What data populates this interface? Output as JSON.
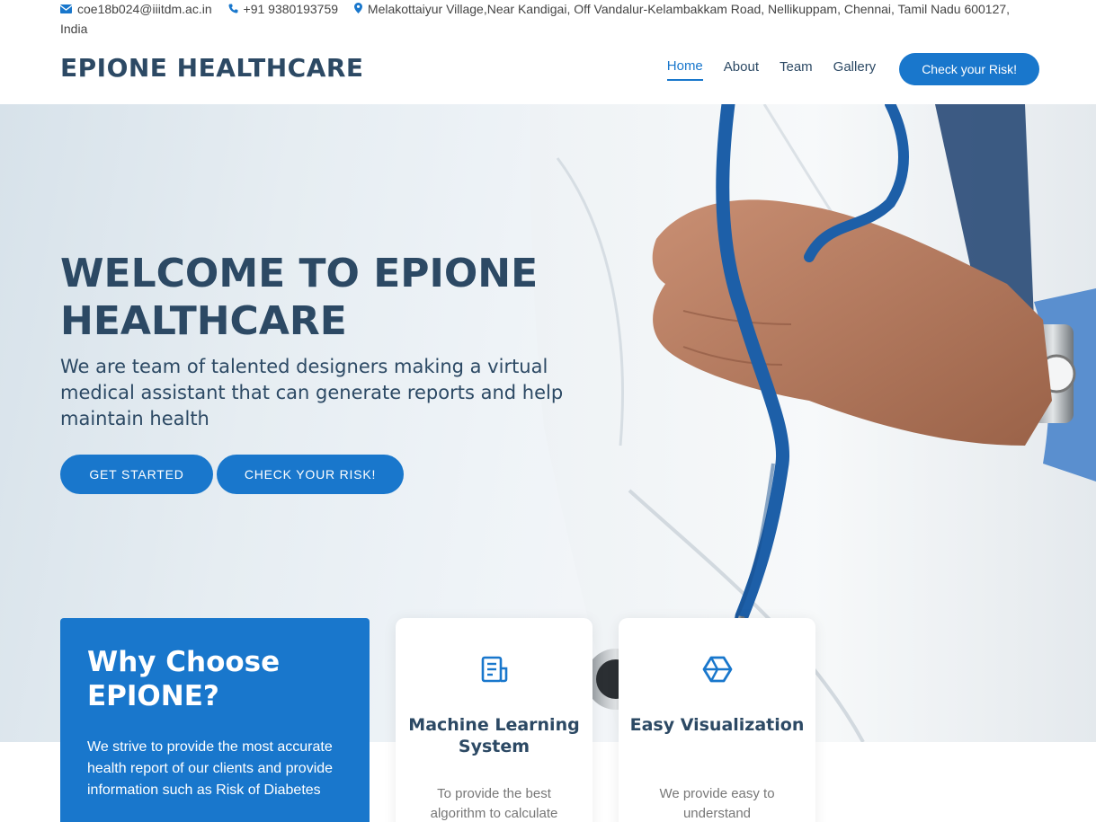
{
  "topbar": {
    "email": "coe18b024@iiitdm.ac.in",
    "phone": "+91 9380193759",
    "address": "Melakottaiyur Village,Near Kandigai, Off Vandalur-Kelambakkam Road, Nellikuppam, Chennai, Tamil Nadu 600127, India",
    "icons": [
      "envelope-icon",
      "phone-icon",
      "map-pin-icon"
    ]
  },
  "header": {
    "logo": "EPIONE HEALTHCARE",
    "nav": [
      {
        "label": "Home",
        "active": true
      },
      {
        "label": "About"
      },
      {
        "label": "Team"
      },
      {
        "label": "Gallery"
      }
    ],
    "cta": "Check your Risk!"
  },
  "hero": {
    "title": "WELCOME TO EPIONE HEALTHCARE",
    "subtitle": "We are team of talented designers making a virtual medical assistant that can generate reports and help maintain health",
    "buttons": [
      "GET STARTED",
      "CHECK YOUR RISK!"
    ]
  },
  "why": {
    "title": "Why Choose EPIONE?",
    "text": "We strive to provide the most accurate health report of our clients and provide information such as Risk of Diabetes"
  },
  "cards": [
    {
      "icon": "document-icon",
      "title": "Machine Learning System",
      "text": "To provide the best algorithm to calculate"
    },
    {
      "icon": "cube-icon",
      "title": "Easy Visualization",
      "text": "We provide easy to understand"
    }
  ],
  "colors": {
    "accent": "#1977cc",
    "heading": "#2c4964"
  }
}
